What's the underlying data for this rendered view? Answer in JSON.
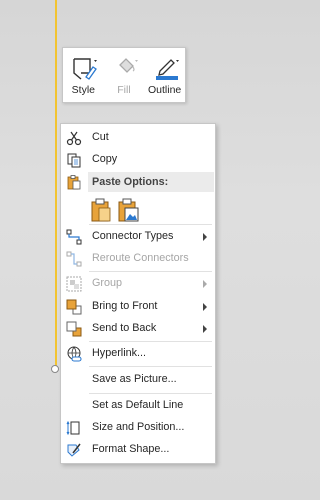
{
  "mini_toolbar": {
    "buttons": [
      {
        "label": "Style",
        "icon": "style-icon",
        "enabled": true
      },
      {
        "label": "Fill",
        "icon": "fill-bucket-icon",
        "enabled": false
      },
      {
        "label": "Outline",
        "icon": "outline-pen-icon",
        "enabled": true
      }
    ]
  },
  "menu": {
    "cut": "Cut",
    "copy": "Copy",
    "paste_header": "Paste Options:",
    "connector_types": "Connector Types",
    "reroute_connectors": "Reroute Connectors",
    "group": "Group",
    "bring_to_front": "Bring to Front",
    "send_to_back": "Send to Back",
    "hyperlink": "Hyperlink...",
    "save_as_picture": "Save as Picture...",
    "set_as_default_line": "Set as Default Line",
    "size_and_position": "Size and Position...",
    "format_shape": "Format Shape..."
  },
  "colors": {
    "selection_line": "#f2c431",
    "accent_blue": "#2b79d0",
    "icon_orange": "#e8a33a"
  }
}
